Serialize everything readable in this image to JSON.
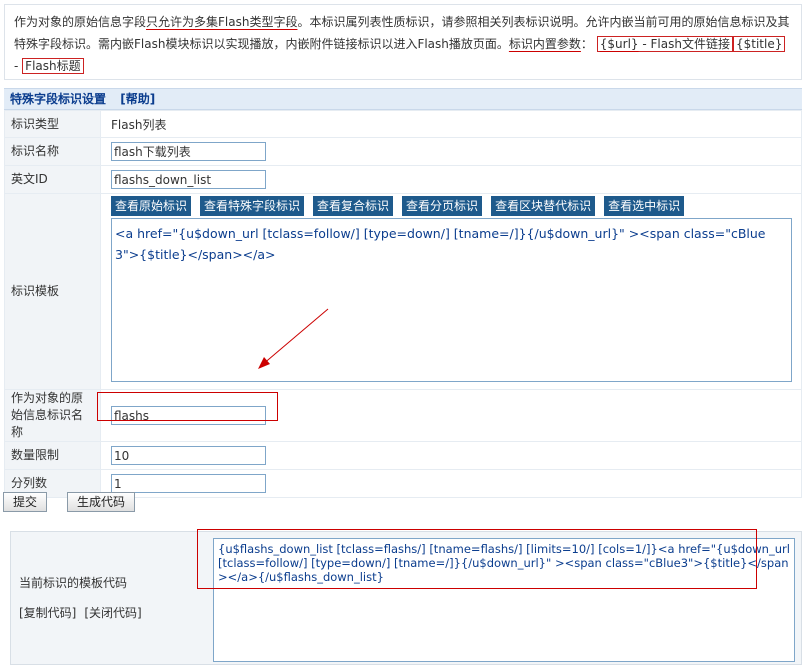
{
  "intro": {
    "p1": "作为对象的原始信息字段",
    "p2": "只允许为多集Flash类型字段",
    "p3": "。本标识属列表性质标识，请参照相关列表标识说明。允许内嵌当前可用的原始信息标识及其特殊字段标识。需内嵌Flash模块标识以实现播放，内嵌附件链接标识以进入Flash播放页面。",
    "p4": "标识内置参数",
    "p5": "：",
    "url_tag": "{$url}",
    "url_desc": " - Flash文件链接",
    "title_tag": "{$title}",
    "title_desc_1": " -",
    "title_desc_2": "Flash标题"
  },
  "section": {
    "title": "特殊字段标识设置",
    "help": "[帮助]"
  },
  "form": {
    "type_label": "标识类型",
    "type_value": "Flash列表",
    "name_label": "标识名称",
    "name_value": "flash下载列表",
    "id_label": "英文ID",
    "id_value": "flashs_down_list",
    "template_label": "标识模板",
    "buttons": [
      "查看原始标识",
      "查看特殊字段标识",
      "查看复合标识",
      "查看分页标识",
      "查看区块替代标识",
      "查看选中标识"
    ],
    "template_value": "<a href=\"{u$down_url [tclass=follow/] [type=down/] [tname=/]}{/u$down_url}\" ><span class=\"cBlue3\">{$title}</span></a>",
    "source_label": "作为对象的原始信息标识名称",
    "source_value": "flashs",
    "limit_label": "数量限制",
    "limit_value": "10",
    "cols_label": "分列数",
    "cols_value": "1"
  },
  "actions": {
    "submit": "提交",
    "generate": "生成代码"
  },
  "code": {
    "label": "当前标识的模板代码",
    "copy": "[复制代码]",
    "close": "[关闭代码]",
    "value": "{u$flashs_down_list [tclass=flashs/] [tname=flashs/] [limits=10/] [cols=1/]}<a href=\"{u$down_url [tclass=follow/] [type=down/] [tname=/]}{/u$down_url}\" ><span class=\"cBlue3\">{$title}</span></a>{/u$flashs_down_list}"
  },
  "colors": {
    "accent_blue": "#1e5a8c",
    "header_bg": "#e2ecf7",
    "annotation_red": "#cc0000"
  }
}
